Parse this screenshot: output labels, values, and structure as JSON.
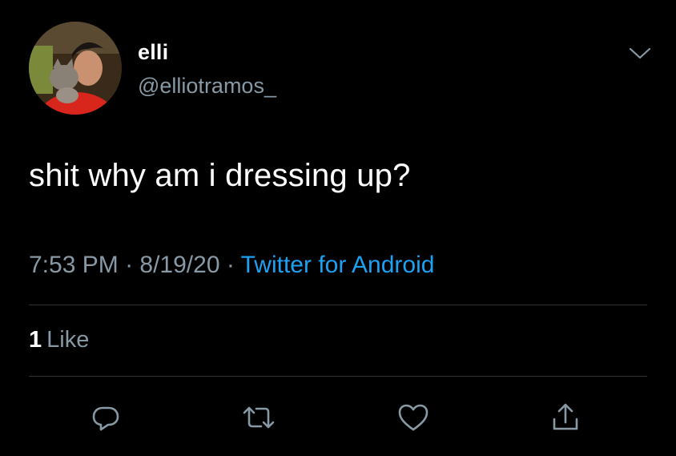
{
  "author": {
    "display_name": "elli",
    "handle": "@elliotramos_"
  },
  "tweet": {
    "text": "shit why am i dressing up?"
  },
  "meta": {
    "time": "7:53 PM",
    "separator": "·",
    "date": "8/19/20",
    "source": "Twitter for Android"
  },
  "stats": {
    "like_count": "1",
    "like_label": "Like"
  },
  "actions": [
    {
      "icon": "reply-icon"
    },
    {
      "icon": "retweet-icon"
    },
    {
      "icon": "heart-icon"
    },
    {
      "icon": "share-icon"
    }
  ],
  "colors": {
    "background": "#000000",
    "secondary_text": "#8899a6",
    "link": "#1da1f2",
    "divider": "#2f3336"
  }
}
